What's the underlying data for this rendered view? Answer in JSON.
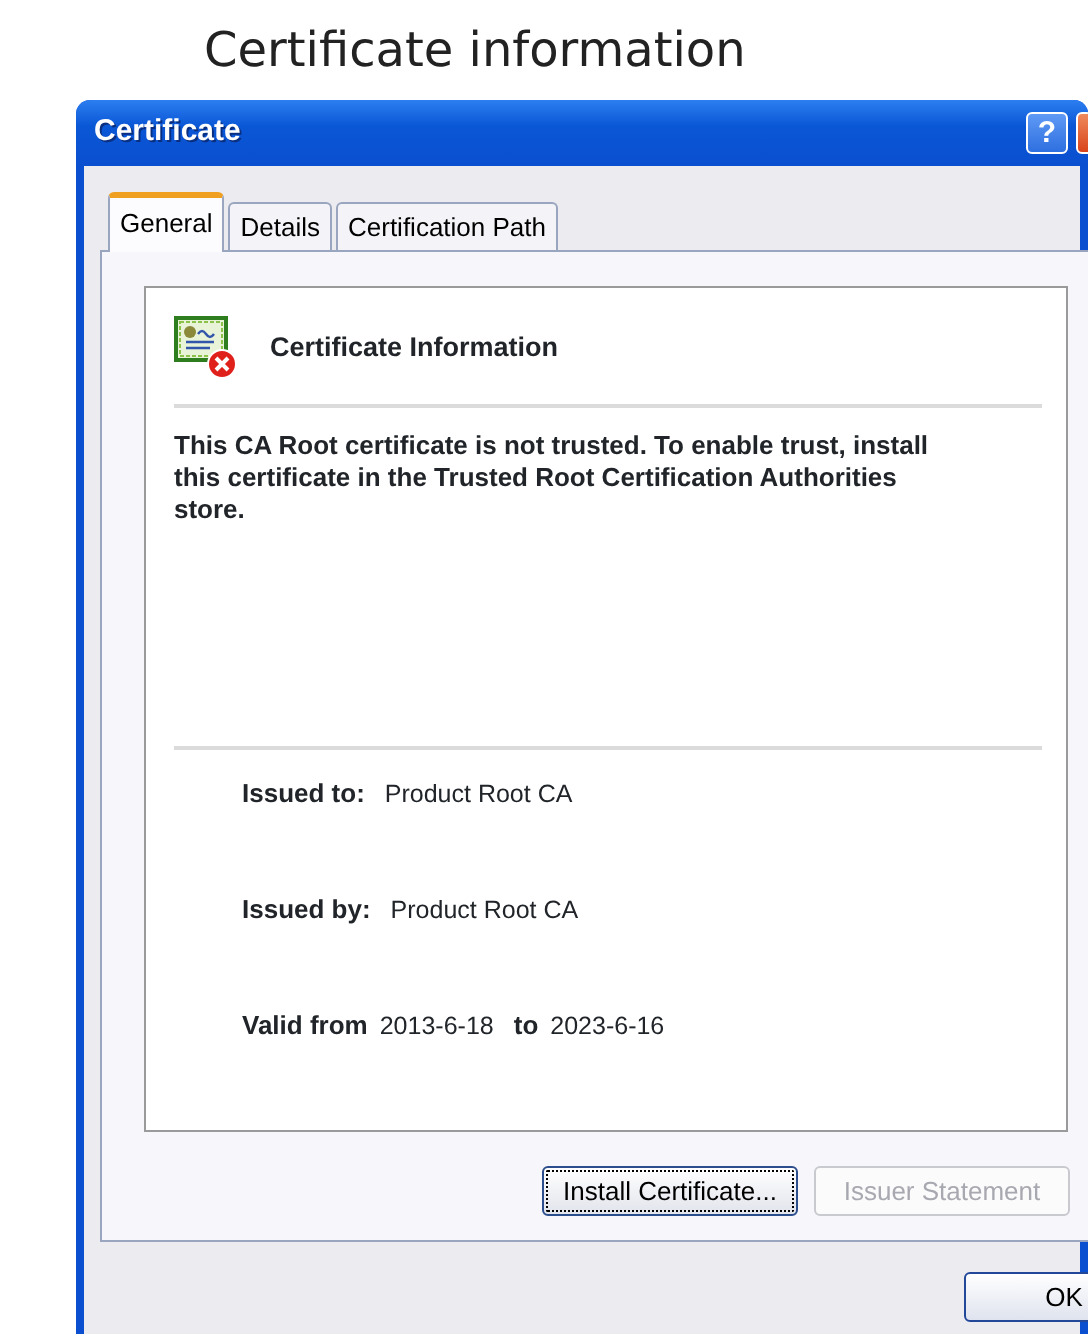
{
  "heading": "Certificate information",
  "window": {
    "title": "Certificate",
    "help_button": "?"
  },
  "tabs": [
    {
      "label": "General",
      "selected": true
    },
    {
      "label": "Details",
      "selected": false
    },
    {
      "label": "Certification Path",
      "selected": false
    }
  ],
  "info": {
    "title": "Certificate Information",
    "message": "This CA Root certificate is not trusted. To enable trust, install this certificate in the Trusted Root Certification Authorities store.",
    "fields": [
      {
        "label": "Issued to:",
        "value": "Product Root CA"
      },
      {
        "label": "Issued by:",
        "value": "Product Root CA"
      }
    ],
    "validity": {
      "from_label": "Valid from",
      "from": "2013-6-18",
      "to_label": "to",
      "to": "2023-6-16"
    }
  },
  "panel_buttons": [
    {
      "label": "Install Certificate...",
      "disabled": false,
      "focused": true
    },
    {
      "label": "Issuer Statement",
      "disabled": true,
      "focused": false
    }
  ],
  "dialog_buttons": [
    {
      "label": "OK"
    }
  ]
}
